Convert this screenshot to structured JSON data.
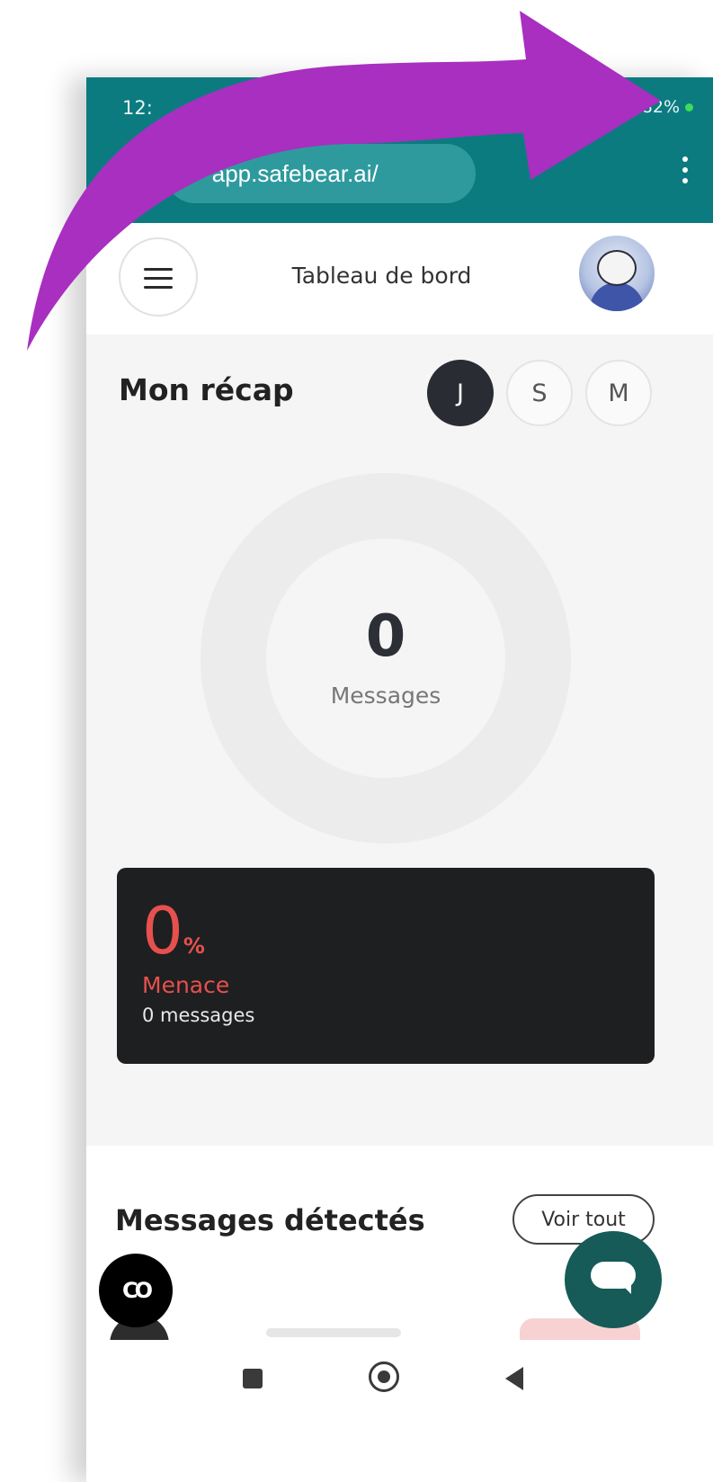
{
  "status_bar": {
    "time": "12:",
    "battery": "82%"
  },
  "browser": {
    "url": "app.safebear.ai/",
    "icons": [
      "tab-icon",
      "site-settings-icon",
      "more-vert-icon"
    ]
  },
  "header": {
    "title": "Tableau de bord"
  },
  "recap": {
    "title": "Mon récap",
    "periods": [
      "J",
      "S",
      "M"
    ],
    "active_period": "J",
    "count": "0",
    "count_label": "Messages"
  },
  "threat": {
    "percent": "0",
    "percent_sign": "%",
    "label": "Menace",
    "sub": "0 messages"
  },
  "detected": {
    "title": "Messages détectés",
    "see_all": "Voir tout"
  },
  "colors": {
    "browser_bar": "#0b7b80",
    "threat": "#e6504e",
    "chat_fab": "#165b58",
    "arrow": "#a82fc0"
  }
}
